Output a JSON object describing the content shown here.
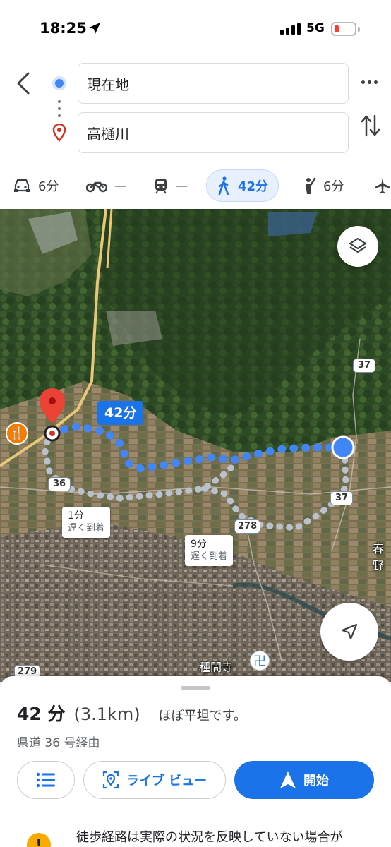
{
  "status_bar": {
    "time": "18:25",
    "network": "5G"
  },
  "route": {
    "origin": "現在地",
    "destination": "高樋川"
  },
  "travel_modes": [
    {
      "mode": "car",
      "icon": "car-icon",
      "value": "6分"
    },
    {
      "mode": "motorcycle",
      "icon": "motorcycle-icon",
      "value": "—"
    },
    {
      "mode": "transit",
      "icon": "train-icon",
      "value": "—"
    },
    {
      "mode": "walk",
      "icon": "walk-icon",
      "value": "42分",
      "selected": true
    },
    {
      "mode": "ride",
      "icon": "ride-hailing-icon",
      "value": "6分"
    },
    {
      "mode": "flight",
      "icon": "airplane-icon",
      "value": ""
    }
  ],
  "map": {
    "route_time_label": "42分",
    "alt_routes": [
      {
        "time": "1分",
        "note": "遅く到着"
      },
      {
        "time": "9分",
        "note": "遅く到着"
      }
    ],
    "road_shields": [
      "37",
      "36",
      "37",
      "278",
      "279"
    ],
    "place_labels": {
      "temple": "種間寺",
      "area": "春野"
    },
    "colors": {
      "route": "#4285f4",
      "alt_route": "#b8c2cc"
    }
  },
  "sheet": {
    "duration": "42 分",
    "distance": "(3.1km)",
    "terrain": "ほぼ平坦です。",
    "via": "県道 36 号経由",
    "live_view_label": "ライブ ビュー",
    "start_label": "開始",
    "warning": "徒歩経路は実際の状況を反映していない場合が"
  }
}
